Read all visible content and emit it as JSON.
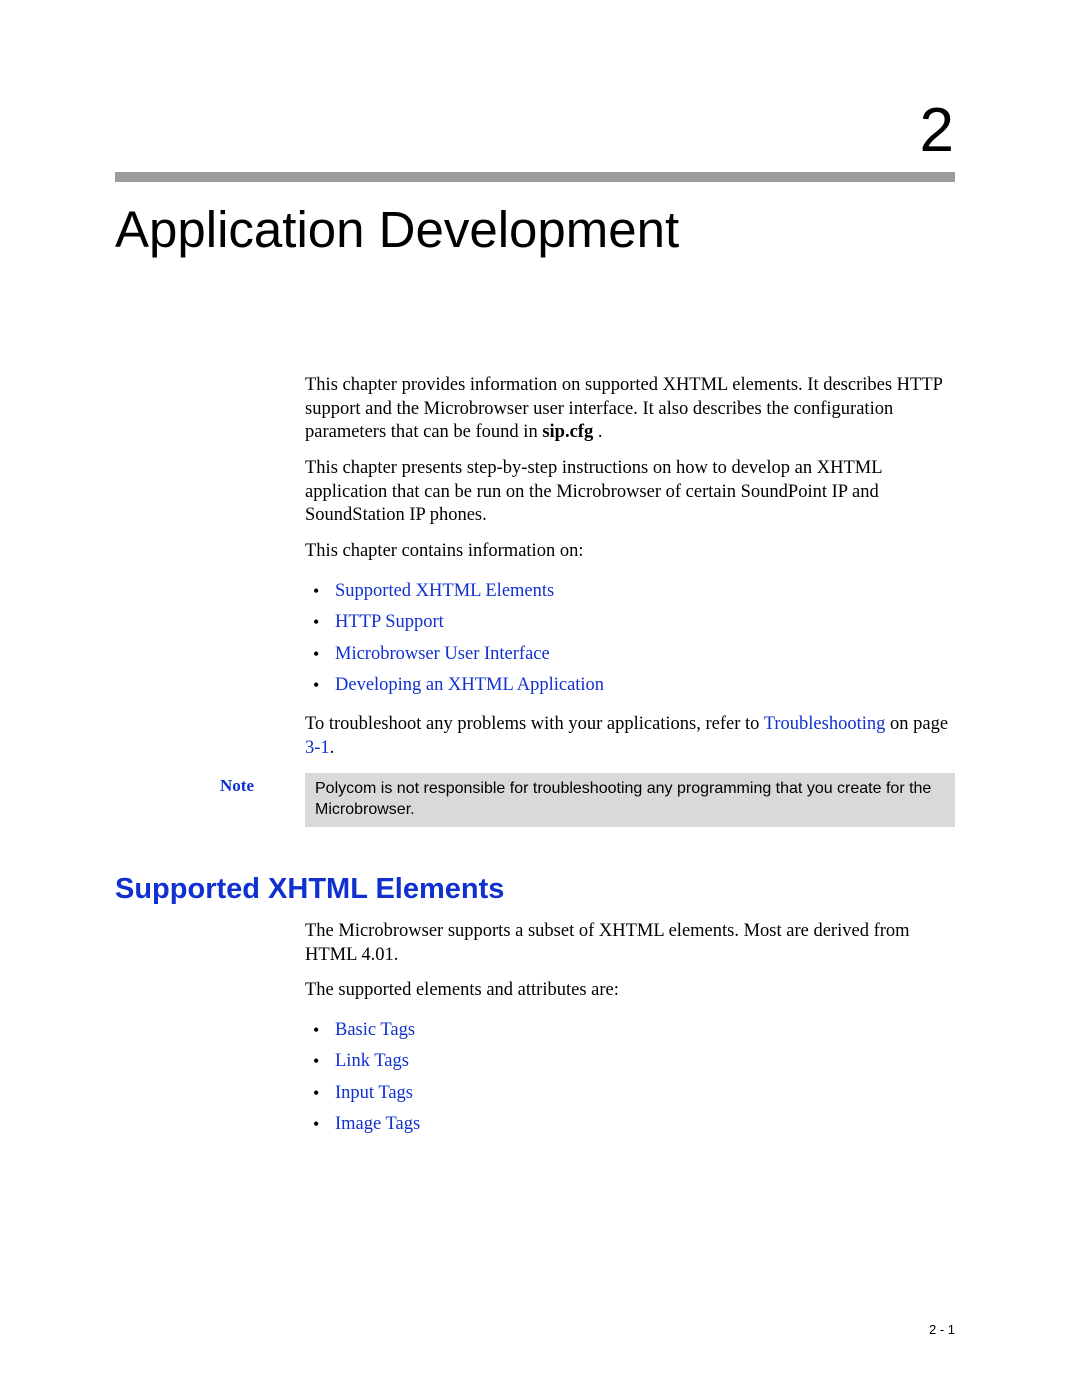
{
  "chapter": {
    "number": "2",
    "title": "Application Development"
  },
  "intro": {
    "p1_a": "This chapter provides information on supported XHTML elements. It describes HTTP support and the Microbrowser user interface. It also describes the configuration parameters that can be found in ",
    "p1_bold": "sip.cfg",
    "p1_b": " .",
    "p2": "This chapter presents step-by-step instructions on how to develop an XHTML application that can be run on the Microbrowser of certain SoundPoint IP and SoundStation IP phones.",
    "p3": "This chapter contains information on:",
    "bullets": [
      "Supported XHTML Elements",
      "HTTP Support",
      "Microbrowser User Interface",
      "Developing an XHTML Application"
    ],
    "p4_a": "To troubleshoot any problems with your applications, refer to ",
    "p4_link": "Troubleshooting",
    "p4_b": " on page ",
    "p4_page": "3-1",
    "p4_c": "."
  },
  "note": {
    "label": "Note",
    "text": "Polycom is not responsible for troubleshooting any programming that you create for the Microbrowser."
  },
  "section": {
    "title": "Supported XHTML Elements",
    "p1": "The Microbrowser supports a subset of XHTML elements. Most are derived from HTML 4.01.",
    "p2": "The supported elements and attributes are:",
    "bullets": [
      "Basic Tags",
      "Link Tags",
      "Input Tags",
      "Image Tags"
    ]
  },
  "footer": {
    "page": "2 - 1"
  }
}
